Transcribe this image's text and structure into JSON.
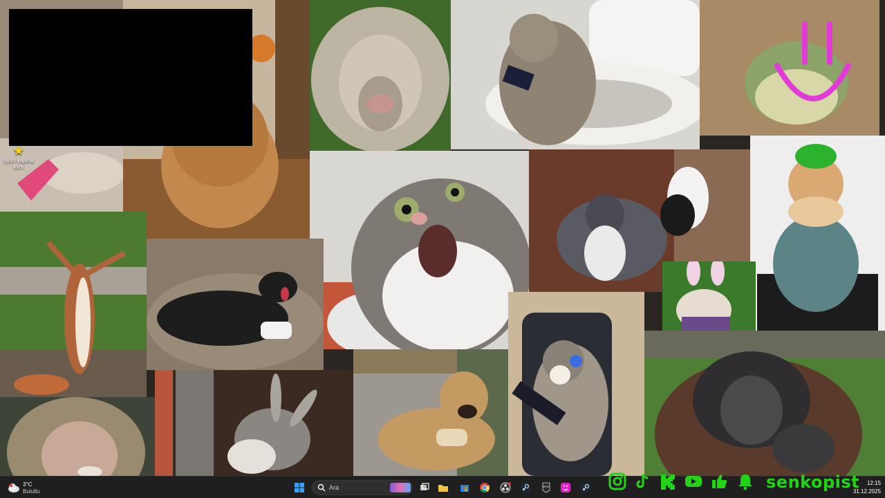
{
  "desktop": {
    "icon_label": "oydn yapma\nksnr",
    "tiles": [
      "photo-dog-with-object-on-head",
      "photo-fluffy-sheep",
      "photo-cat-on-toilet-with-phone",
      "photo-frog-with-smiley",
      "photo-dog-on-blanket",
      "photo-shocked-cat",
      "photo-dog-and-cat-fighting",
      "photo-cat-with-green-hat",
      "photo-squirrel-arms-up",
      "photo-black-dog-with-controller",
      "photo-bulldog-bunny-ears",
      "photo-gamer-cat-with-headset",
      "photo-orangutan",
      "photo-monkey-face",
      "photo-donkey",
      "photo-dog-with-bread"
    ]
  },
  "taskbar": {
    "weather": {
      "temp": "3°C",
      "condition": "Bulutlu"
    },
    "search": {
      "label": "Ara"
    },
    "social_icons": [
      "instagram-icon",
      "tiktok-icon",
      "kick-icon",
      "youtube-icon",
      "like-icon",
      "bell-icon"
    ],
    "brand": "senkopist",
    "clock": {
      "time": "12:15",
      "date": "31.12.2025"
    }
  },
  "colors": {
    "brand_green": "#22d316",
    "taskbar_bg": "#1f1f1f"
  }
}
